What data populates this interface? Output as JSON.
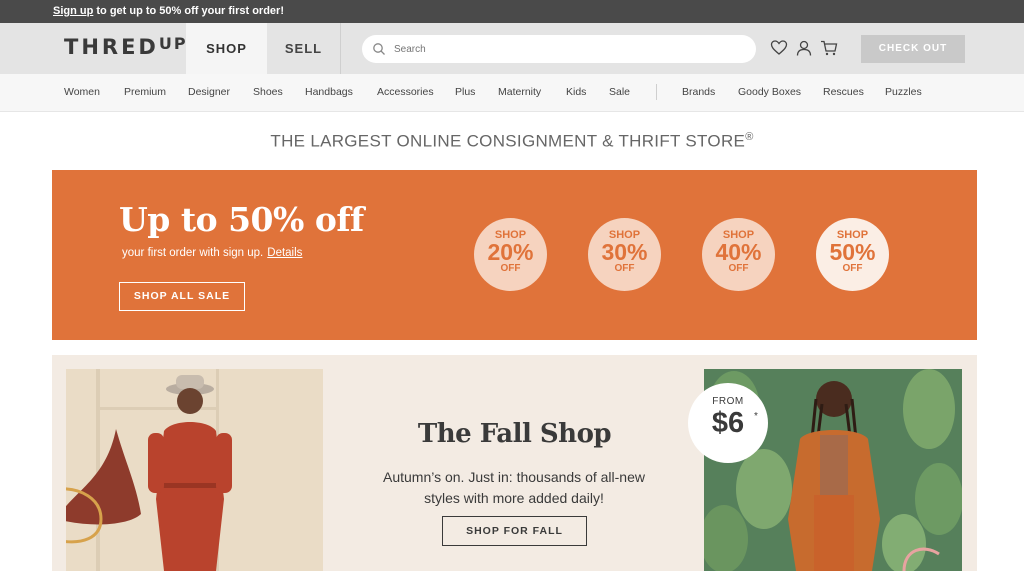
{
  "promo": {
    "signup_link": "Sign up",
    "text": " to get up to 50% off your first order!"
  },
  "header": {
    "logo": "THRED",
    "logo_suffix": "UP",
    "tabs": [
      "SHOP",
      "SELL"
    ],
    "search_placeholder": "Search",
    "icons": [
      "heart-icon",
      "user-icon",
      "cart-icon"
    ],
    "checkout_label": "CHECK OUT"
  },
  "nav": {
    "items": [
      "Women",
      "Premium",
      "Designer",
      "Shoes",
      "Handbags",
      "Accessories",
      "Plus",
      "Maternity",
      "Kids",
      "Sale"
    ],
    "items_right": [
      "Brands",
      "Goody Boxes",
      "Rescues",
      "Puzzles"
    ]
  },
  "tagline": {
    "text": "THE LARGEST ONLINE CONSIGNMENT & THRIFT STORE",
    "mark": "®"
  },
  "sale": {
    "title": "Up to 50% off",
    "subtitle": "your first order with sign up.",
    "details_link": "Details",
    "button": "SHOP ALL SALE",
    "circles": [
      {
        "top": "SHOP",
        "pct": "20%",
        "bottom": "OFF"
      },
      {
        "top": "SHOP",
        "pct": "30%",
        "bottom": "OFF"
      },
      {
        "top": "SHOP",
        "pct": "40%",
        "bottom": "OFF"
      },
      {
        "top": "SHOP",
        "pct": "50%",
        "bottom": "OFF"
      }
    ],
    "colors": {
      "banner": "#e0733a",
      "circle": "#f6d3bf"
    }
  },
  "fall": {
    "title": "The Fall Shop",
    "subtitle": "Autumn’s on. Just in: thousands of all-new styles with more added daily!",
    "button": "SHOP FOR FALL",
    "badge_from": "FROM",
    "badge_price": "$6",
    "badge_mark": "*"
  }
}
